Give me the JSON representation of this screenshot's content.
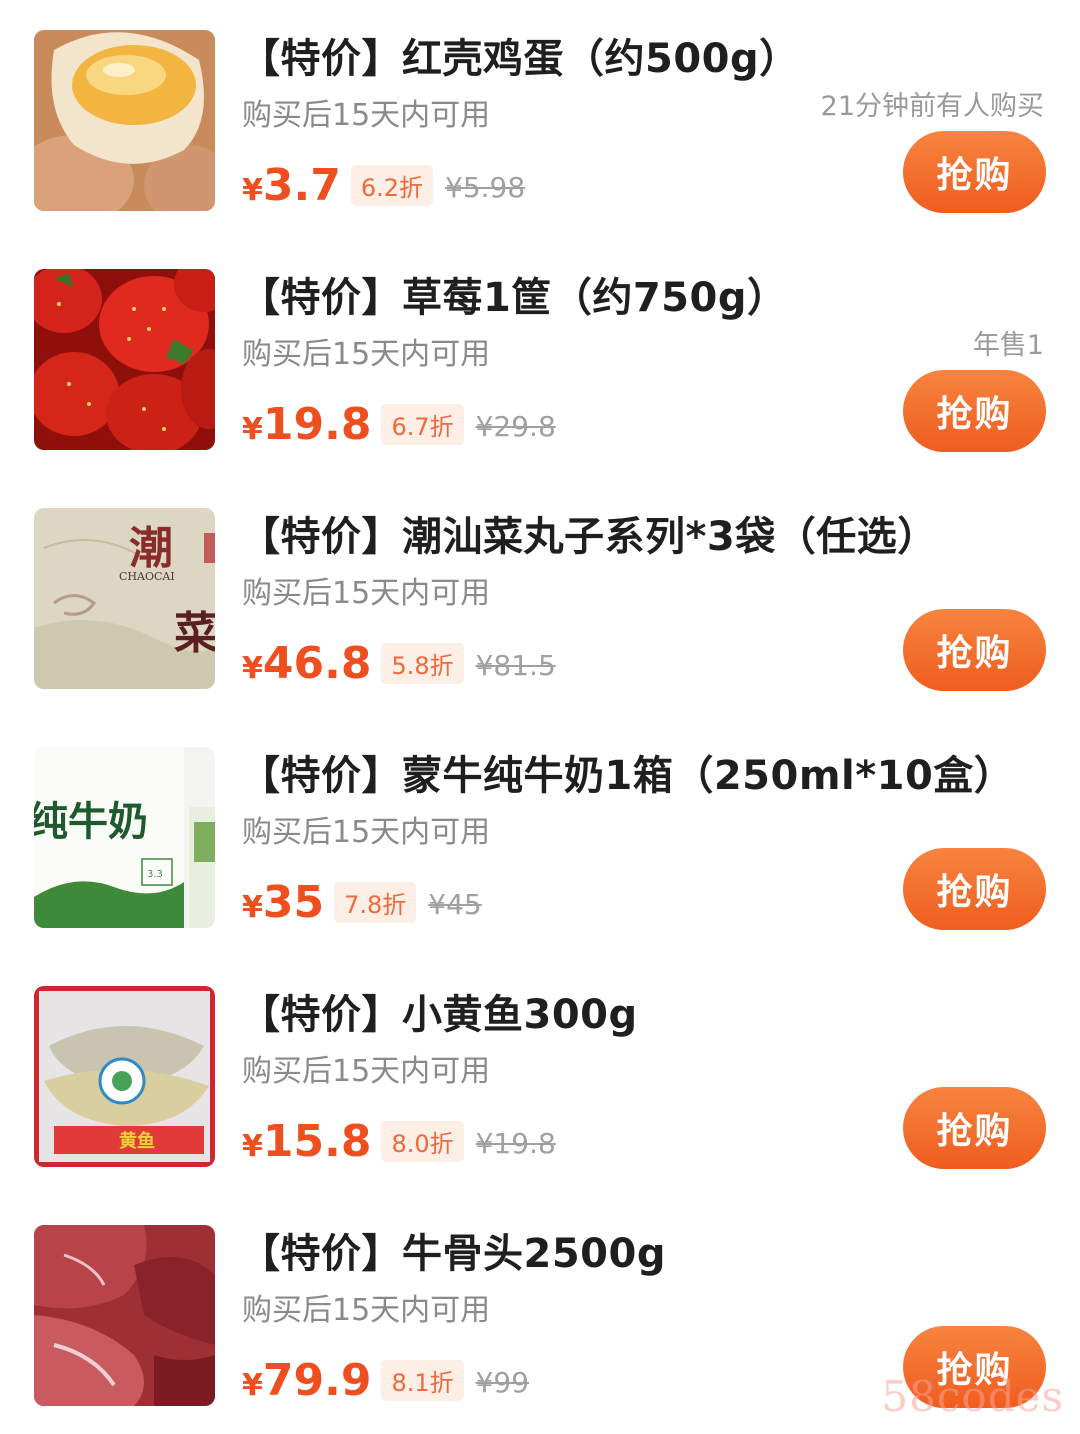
{
  "items": [
    {
      "title": "【特价】红壳鸡蛋（约500g）",
      "validity": "购买后15天内可用",
      "note": "21分钟前有人购买",
      "currency": "¥",
      "price": "3.7",
      "discount": "6.2折",
      "original_price": "¥5.98",
      "button": "抢购",
      "image": "eggs-image"
    },
    {
      "title": "【特价】草莓1筐（约750g）",
      "validity": "购买后15天内可用",
      "note": "年售1",
      "currency": "¥",
      "price": "19.8",
      "discount": "6.7折",
      "original_price": "¥29.8",
      "button": "抢购",
      "image": "strawberries-image"
    },
    {
      "title": "【特价】潮汕菜丸子系列*3袋（任选）",
      "validity": "购买后15天内可用",
      "note": "",
      "currency": "¥",
      "price": "46.8",
      "discount": "5.8折",
      "original_price": "¥81.5",
      "button": "抢购",
      "image": "chaoshan-meatball-package-image",
      "image_text": [
        "潮",
        "菜",
        "CHAOCAI"
      ]
    },
    {
      "title": "【特价】蒙牛纯牛奶1箱（250ml*10盒）",
      "validity": "购买后15天内可用",
      "note": "",
      "currency": "¥",
      "price": "35",
      "discount": "7.8折",
      "original_price": "¥45",
      "button": "抢购",
      "image": "milk-box-image",
      "image_text": [
        "纯牛奶",
        "3.3"
      ]
    },
    {
      "title": "【特价】小黄鱼300g",
      "validity": "购买后15天内可用",
      "note": "",
      "currency": "¥",
      "price": "15.8",
      "discount": "8.0折",
      "original_price": "¥19.8",
      "button": "抢购",
      "image": "yellow-croaker-image",
      "image_text": [
        "黄鱼"
      ]
    },
    {
      "title": "【特价】牛骨头2500g",
      "validity": "购买后15天内可用",
      "note": "",
      "currency": "¥",
      "price": "79.9",
      "discount": "8.1折",
      "original_price": "¥99",
      "button": "抢购",
      "image": "beef-bones-image"
    }
  ],
  "watermark": "58codes",
  "colors": {
    "price": "#ef4f1f",
    "button": "#ef5d1f",
    "discount_bg": "#fdeee6"
  }
}
